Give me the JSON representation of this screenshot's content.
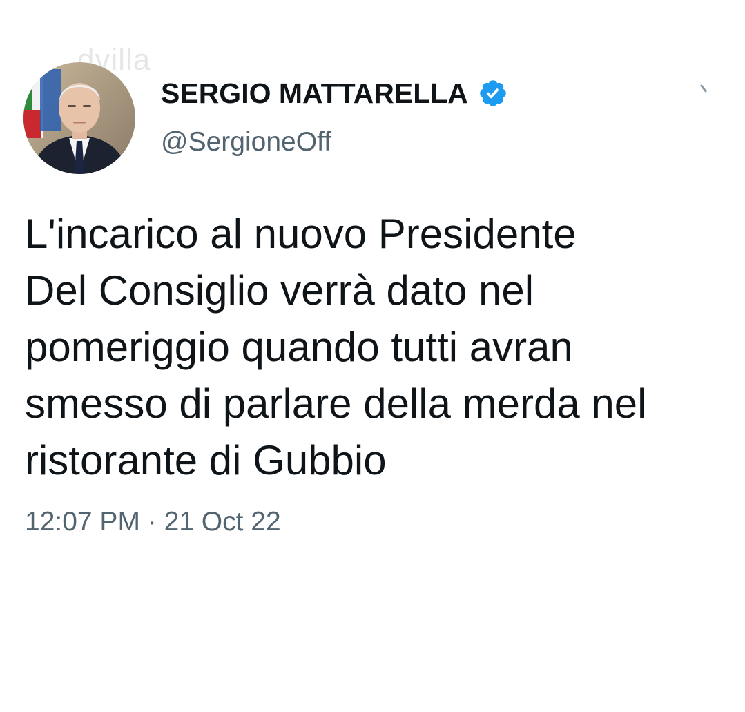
{
  "watermark": "dvilla",
  "author": {
    "display_name": "SERGIO MATTARELLA",
    "handle": "@SergioneOff",
    "verified": true,
    "avatar_icon": "profile-photo",
    "verified_icon": "verified-badge-icon"
  },
  "tweet": {
    "lines": [
      "L'incarico al nuovo Presidente",
      "Del Consiglio verrà dato nel",
      "pomeriggio quando tutti avran",
      "smesso di parlare della merda nel",
      "ristorante di Gubbio"
    ],
    "timestamp": "12:07 PM · 21 Oct 22"
  },
  "colors": {
    "text_primary": "#0f1419",
    "text_secondary": "#536471",
    "verified_blue": "#1d9bf0",
    "background": "#ffffff"
  }
}
